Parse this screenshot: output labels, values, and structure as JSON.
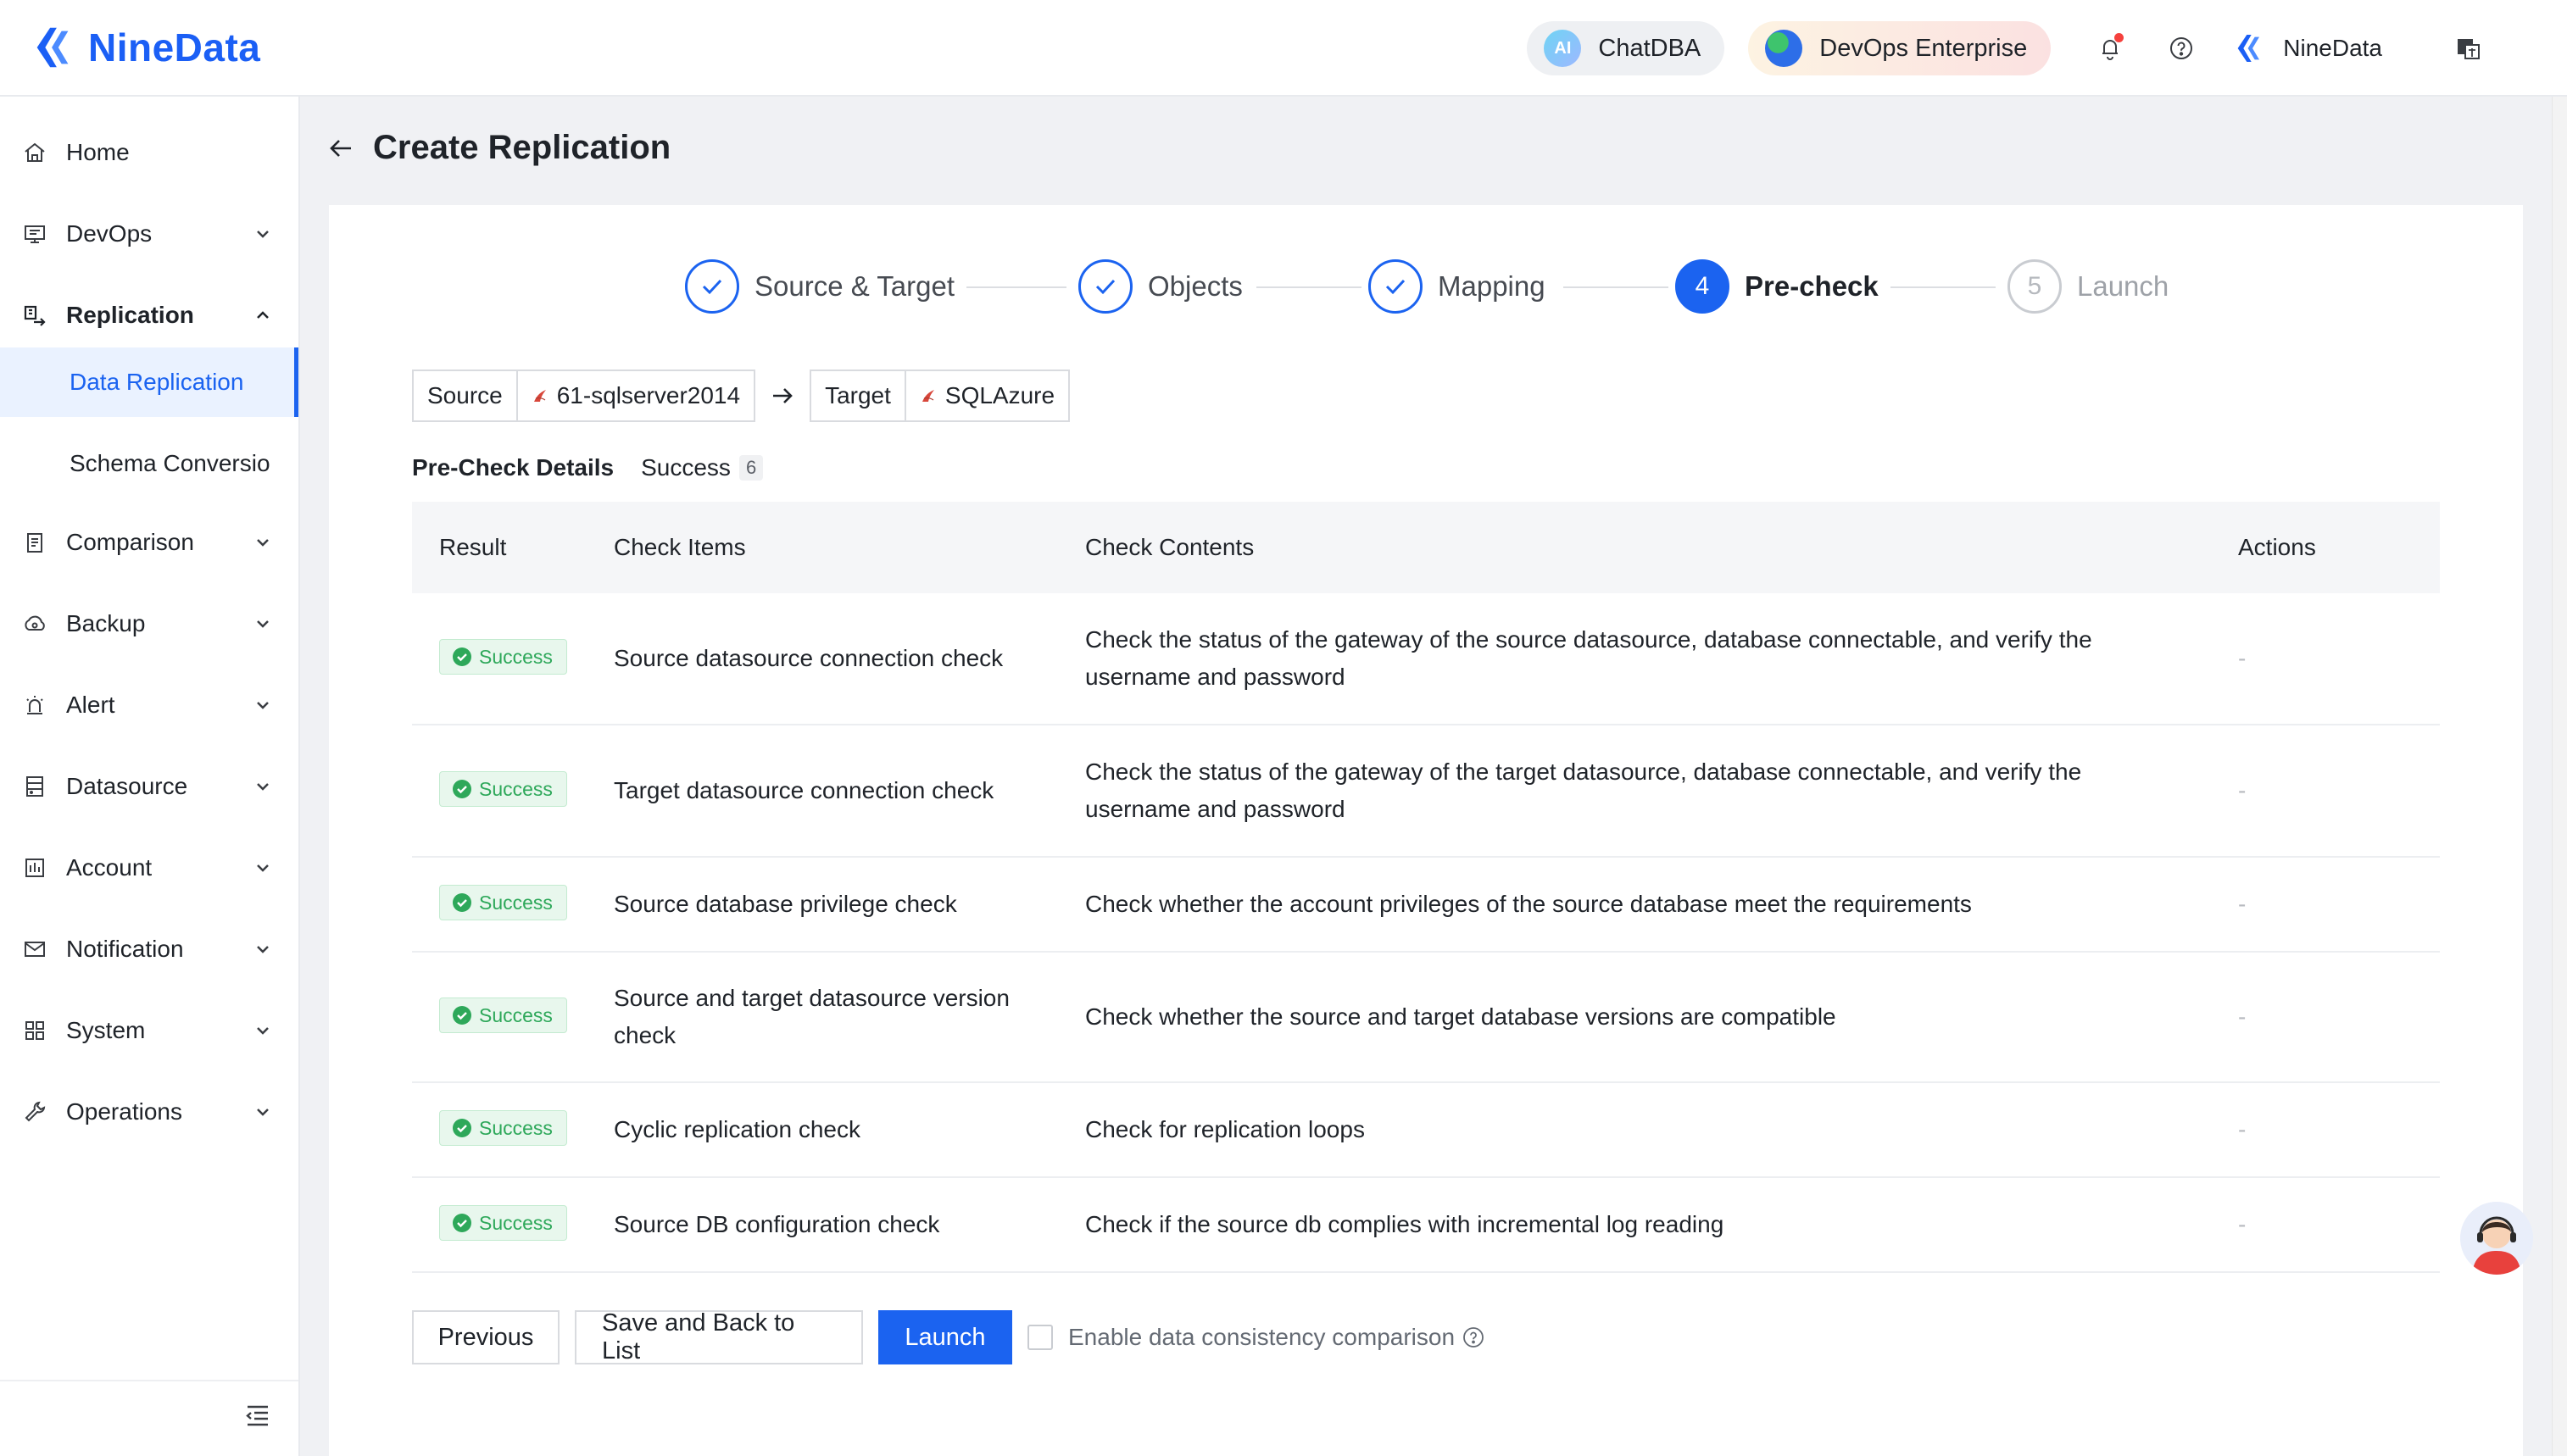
{
  "app": {
    "logo_text": "NineData",
    "brand_color": "#1b5ff5"
  },
  "header": {
    "chatdba_label": "ChatDBA",
    "chatdba_icon_text": "AI",
    "devops_label": "DevOps Enterprise",
    "user_name": "NineData",
    "icons": [
      "bell-icon",
      "help-icon",
      "ninedata-user-icon",
      "translate-icon"
    ]
  },
  "sidebar": {
    "items": [
      {
        "label": "Home",
        "icon": "home-icon"
      },
      {
        "label": "DevOps",
        "icon": "devops-icon"
      },
      {
        "label": "Replication",
        "icon": "replication-icon"
      },
      {
        "label": "Comparison",
        "icon": "comparison-icon"
      },
      {
        "label": "Backup",
        "icon": "backup-icon"
      },
      {
        "label": "Alert",
        "icon": "alert-icon"
      },
      {
        "label": "Datasource",
        "icon": "datasource-icon"
      },
      {
        "label": "Account",
        "icon": "account-icon"
      },
      {
        "label": "Notification",
        "icon": "notification-icon"
      },
      {
        "label": "System",
        "icon": "system-icon"
      },
      {
        "label": "Operations",
        "icon": "operations-icon"
      }
    ],
    "sub_items": [
      {
        "label": "Data Replication",
        "active": true
      },
      {
        "label": "Schema Conversio",
        "active": false
      }
    ]
  },
  "page": {
    "title": "Create Replication"
  },
  "steps": [
    {
      "label": "Source & Target",
      "state": "done"
    },
    {
      "label": "Objects",
      "state": "done"
    },
    {
      "label": "Mapping",
      "state": "done"
    },
    {
      "label": "Pre-check",
      "number": "4",
      "state": "current"
    },
    {
      "label": "Launch",
      "number": "5",
      "state": "future"
    }
  ],
  "route": {
    "source_label": "Source",
    "source_value": "61-sqlserver2014",
    "target_label": "Target",
    "target_value": "SQLAzure"
  },
  "precheck": {
    "title": "Pre-Check Details",
    "status_label": "Success",
    "count": "6"
  },
  "table": {
    "headers": {
      "result": "Result",
      "items": "Check Items",
      "contents": "Check Contents",
      "actions": "Actions"
    },
    "rows": [
      {
        "result": "Success",
        "item": "Source datasource connection check",
        "content": "Check the status of the gateway of the source datasource, database connectable, and verify the username and password",
        "action": "-"
      },
      {
        "result": "Success",
        "item": "Target datasource connection check",
        "content": "Check the status of the gateway of the target datasource, database connectable, and verify the username and password",
        "action": "-"
      },
      {
        "result": "Success",
        "item": "Source database privilege check",
        "content": "Check whether the account privileges of the source database meet the requirements",
        "action": "-"
      },
      {
        "result": "Success",
        "item": "Source and target datasource version check",
        "content": "Check whether the source and target database versions are compatible",
        "action": "-"
      },
      {
        "result": "Success",
        "item": "Cyclic replication check",
        "content": "Check for replication loops",
        "action": "-"
      },
      {
        "result": "Success",
        "item": "Source DB configuration check",
        "content": "Check if the source db complies with incremental log reading",
        "action": "-"
      }
    ]
  },
  "footer": {
    "previous_label": "Previous",
    "save_label": "Save and Back to List",
    "launch_label": "Launch",
    "consistency_label": "Enable data consistency comparison",
    "consistency_checked": false
  },
  "colors": {
    "accent": "#1b63f0",
    "success": "#2ea85a",
    "success_bg": "#e8f7ed"
  }
}
